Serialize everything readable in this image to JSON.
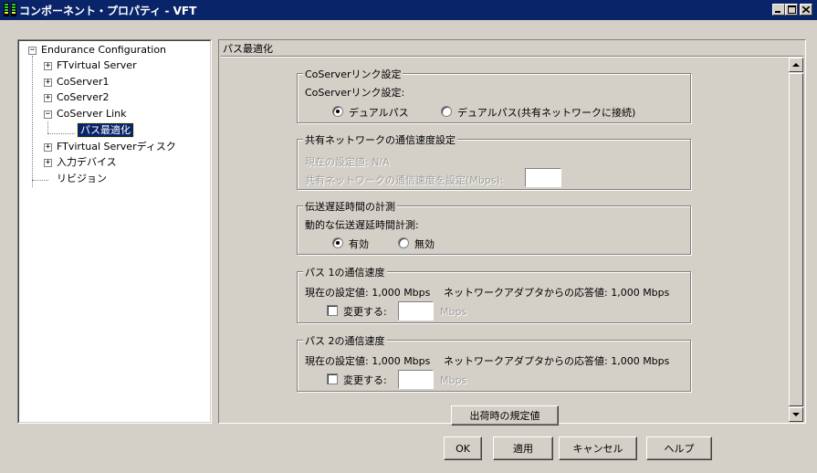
{
  "window": {
    "title": "コンポーネント・プロパティ - VFT",
    "minimize_label": "_",
    "maximize_label": "□",
    "close_label": "×"
  },
  "tree": {
    "root": "Endurance Configuration",
    "items": [
      {
        "label": "FTvirtual Server",
        "expander": "+"
      },
      {
        "label": "CoServer1",
        "expander": "+"
      },
      {
        "label": "CoServer2",
        "expander": "+"
      },
      {
        "label": "CoServer Link",
        "expander": "−"
      },
      {
        "label": "パス最適化",
        "selected": true
      },
      {
        "label": "FTvirtual Serverディスク",
        "expander": "+"
      },
      {
        "label": "入力デバイス",
        "expander": "+"
      },
      {
        "label": "リビジョン"
      }
    ],
    "root_expander": "−"
  },
  "panel": {
    "header": "パス最適化"
  },
  "coserver_link": {
    "group_title": "CoServerリンク設定",
    "label": "CoServerリンク設定:",
    "options": [
      {
        "label": "デュアルパス",
        "checked": true
      },
      {
        "label": "デュアルパス(共有ネットワークに接続)",
        "checked": false
      }
    ]
  },
  "shared_network": {
    "group_title": "共有ネットワークの通信速度設定",
    "current_label": "現在の設定値: N/A",
    "set_label": "共有ネットワークの通信速度を設定(Mbps):",
    "value": ""
  },
  "latency": {
    "group_title": "伝送遅延時間の計測",
    "label": "動的な伝送遅延時間計測:",
    "options": [
      {
        "label": "有効",
        "checked": true
      },
      {
        "label": "無効",
        "checked": false
      }
    ]
  },
  "path1": {
    "group_title": "パス 1の通信速度",
    "current": "現在の設定値: 1,000 Mbps",
    "adapter": "ネットワークアダプタからの応答値: 1,000 Mbps",
    "change_label": "変更する:",
    "value": "",
    "unit": "Mbps"
  },
  "path2": {
    "group_title": "パス 2の通信速度",
    "current": "現在の設定値: 1,000 Mbps",
    "adapter": "ネットワークアダプタからの応答値: 1,000 Mbps",
    "change_label": "変更する:",
    "value": "",
    "unit": "Mbps"
  },
  "defaults_button": "出荷時の規定値",
  "buttons": {
    "ok": "OK",
    "apply": "適用",
    "cancel": "キャンセル",
    "help": "ヘルプ"
  }
}
